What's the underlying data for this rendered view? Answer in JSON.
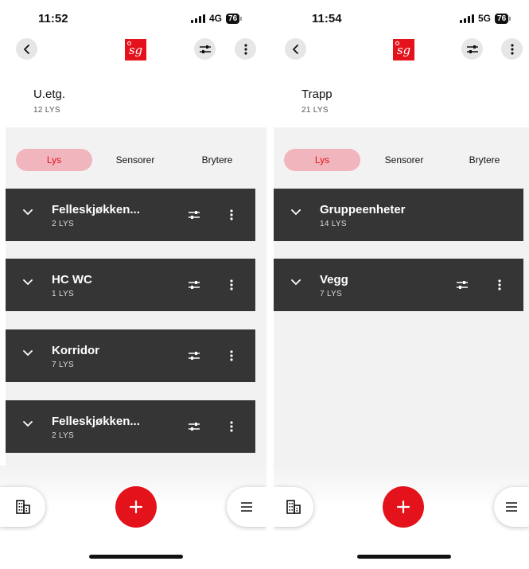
{
  "screens": [
    {
      "status": {
        "time": "11:52",
        "network": "4G",
        "battery": "76"
      },
      "header": {
        "logo_text": "sg"
      },
      "page": {
        "title": "U.etg.",
        "subtitle": "12 LYS"
      },
      "tabs": [
        {
          "label": "Lys",
          "active": true
        },
        {
          "label": "Sensorer",
          "active": false
        },
        {
          "label": "Brytere",
          "active": false
        }
      ],
      "groups": [
        {
          "name": "Felleskjøkken...",
          "count": "2 LYS"
        },
        {
          "name": "HC WC",
          "count": "1 LYS"
        },
        {
          "name": "Korridor",
          "count": "7 LYS"
        },
        {
          "name": "Felleskjøkken...",
          "count": "2 LYS"
        }
      ]
    },
    {
      "status": {
        "time": "11:54",
        "network": "5G",
        "battery": "76"
      },
      "header": {
        "logo_text": "sg"
      },
      "page": {
        "title": "Trapp",
        "subtitle": "21 LYS"
      },
      "tabs": [
        {
          "label": "Lys",
          "active": true
        },
        {
          "label": "Sensorer",
          "active": false
        },
        {
          "label": "Brytere",
          "active": false
        }
      ],
      "groups": [
        {
          "name": "Gruppeenheter",
          "count": "14 LYS"
        },
        {
          "name": "Vegg",
          "count": "7 LYS"
        }
      ]
    }
  ],
  "colors": {
    "accent": "#e3121b",
    "tab_active_bg": "#f1b5bd",
    "card_bg": "#353535",
    "content_bg": "#f2f2f2"
  },
  "icons": {
    "back": "chevron-left-icon",
    "filter": "sliders-icon",
    "more": "more-vertical-icon",
    "expand": "chevron-down-icon",
    "building": "building-icon",
    "add": "plus-icon",
    "menu": "hamburger-icon"
  }
}
